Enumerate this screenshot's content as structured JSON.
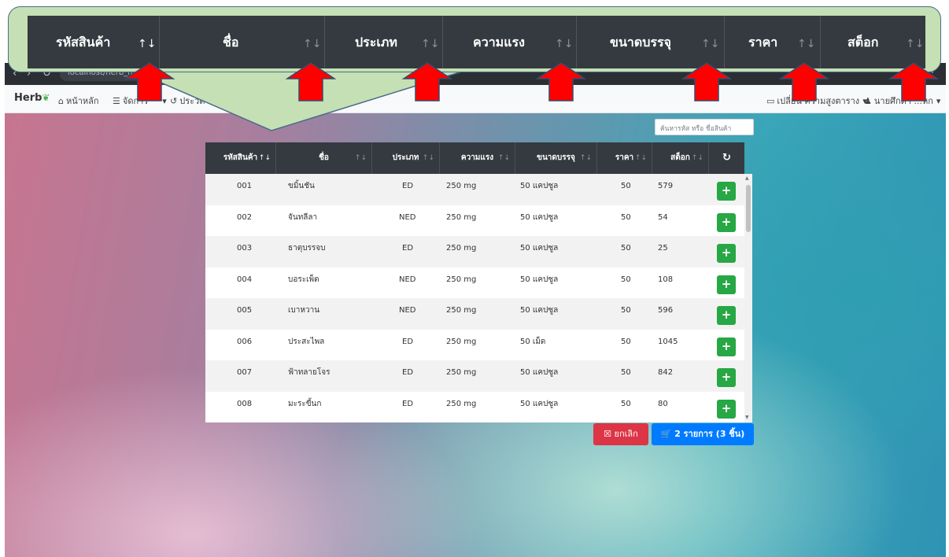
{
  "browser": {
    "url": "localhost/herb_m",
    "menu_glyph": "⋮"
  },
  "navbar": {
    "brand": "Herb",
    "brand_icon": "leaf-icon",
    "items": [
      {
        "label": "หน้าหลัก",
        "icon": "home-icon"
      },
      {
        "label": "จัดการ",
        "icon": "list-icon"
      },
      {
        "label": "ประวัติ",
        "icon": "history-icon"
      }
    ],
    "right_items": [
      {
        "label": "เปลี่ยน ความสูงตาราง",
        "icon": "window-icon"
      },
      {
        "label": "นายศึกดา ...หก",
        "icon": "user-icon"
      }
    ]
  },
  "search": {
    "placeholder": "ค้นหารหัส หรือ ชื่อสินค้า"
  },
  "table": {
    "columns": [
      "รหัสสินค้า",
      "ชื่อ",
      "ประเภท",
      "ความแรง",
      "ขนาดบรรจุ",
      "ราคา",
      "สต็อก"
    ],
    "sort_glyph": "↑↓",
    "refresh_icon": "refresh-icon",
    "refresh_glyph": "↻",
    "rows": [
      {
        "code": "001",
        "name": "ขมิ้นชัน",
        "type": "ED",
        "strength": "250 mg",
        "pack": "50 แคปซูล",
        "price": "50",
        "stock": "579"
      },
      {
        "code": "002",
        "name": "จันทลีลา",
        "type": "NED",
        "strength": "250 mg",
        "pack": "50 แคปซูล",
        "price": "50",
        "stock": "54"
      },
      {
        "code": "003",
        "name": "ธาตุบรรจบ",
        "type": "ED",
        "strength": "250 mg",
        "pack": "50 แคปซูล",
        "price": "50",
        "stock": "25"
      },
      {
        "code": "004",
        "name": "บอระเพ็ด",
        "type": "NED",
        "strength": "250 mg",
        "pack": "50 แคปซูล",
        "price": "50",
        "stock": "108"
      },
      {
        "code": "005",
        "name": "เบาหวาน",
        "type": "NED",
        "strength": "250 mg",
        "pack": "50 แคปซูล",
        "price": "50",
        "stock": "596"
      },
      {
        "code": "006",
        "name": "ประสะไพล",
        "type": "ED",
        "strength": "250 mg",
        "pack": "50 เม็ด",
        "price": "50",
        "stock": "1045"
      },
      {
        "code": "007",
        "name": "ฟ้าทลายโจร",
        "type": "ED",
        "strength": "250 mg",
        "pack": "50 แคปซูล",
        "price": "50",
        "stock": "842"
      },
      {
        "code": "008",
        "name": "มะระขี้นก",
        "type": "ED",
        "strength": "250 mg",
        "pack": "50 แคปซูล",
        "price": "50",
        "stock": "80"
      }
    ],
    "add_glyph": "+"
  },
  "actions": {
    "cancel": "ยกเลิก",
    "cancel_icon": "close-square-icon",
    "cart": "2 รายการ (3 ชิ้น)",
    "cart_icon": "cart-icon"
  },
  "colors": {
    "header_bg": "#343a40",
    "add_green": "#28a745",
    "cancel_red": "#dc3545",
    "cart_blue": "#007bff",
    "callout_green": "#c5e0b4",
    "arrow_red": "#ff0000"
  }
}
